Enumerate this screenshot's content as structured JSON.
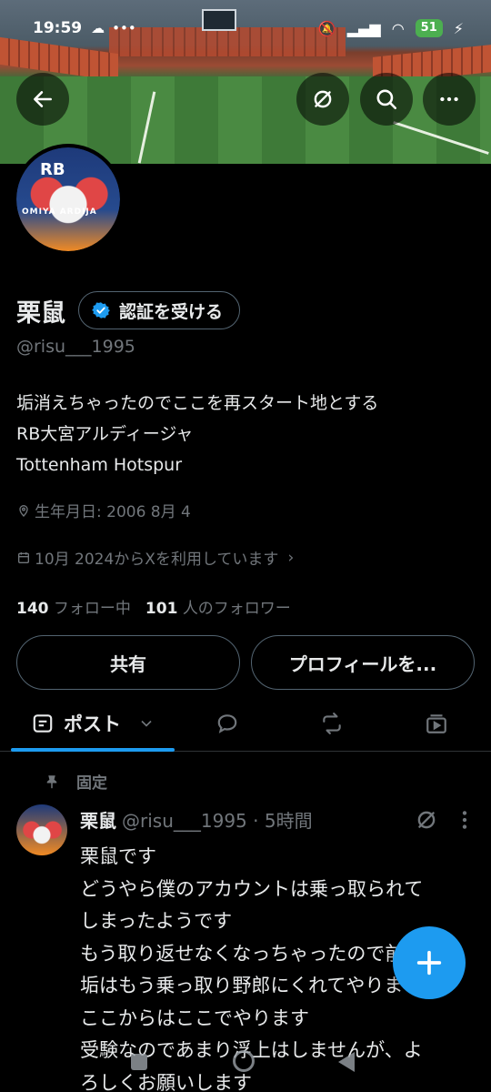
{
  "status_bar": {
    "time": "19:59",
    "battery": "51",
    "icons": [
      "moment-icon",
      "cloud-icon",
      "more-dots",
      "mute-icon",
      "signal-icon",
      "wifi-icon",
      "battery-icon",
      "charging-icon"
    ]
  },
  "top_bar": {
    "back_icon": "arrow-left-icon",
    "grok_icon": "grok-icon",
    "search_icon": "search-icon",
    "more_icon": "more-horizontal-icon"
  },
  "profile": {
    "display_name": "栗鼠",
    "verify_label": "認証を受ける",
    "handle": "@risu___1995",
    "bio_lines": [
      "垢消えちゃったのでここを再スタート地とする",
      "RB大宮アルディージャ",
      "Tottenham Hotspur"
    ],
    "birthday": "生年月日: 2006 8月 4",
    "joined": "10月 2024からXを利用しています",
    "following_count": "140",
    "following_label": "フォロー中",
    "followers_count": "101",
    "followers_label": "人のフォロワー",
    "avatar_text": "RB",
    "avatar_ring_text": "OMIYA ARDIJA"
  },
  "actions": {
    "share_label": "共有",
    "edit_label": "プロフィールを..."
  },
  "tabs": {
    "active_label": "ポスト",
    "items": [
      "posts-tab",
      "replies-tab",
      "reposts-tab",
      "media-tab"
    ]
  },
  "pinned_post": {
    "pinned_label": "固定",
    "author_name": "栗鼠",
    "meta": "@risu___1995 · 5時間",
    "body": "栗鼠です\nどうやら僕のアカウントは乗っ取られて\nしまったようです\nもう取り返せなくなっちゃったので前の\n垢はもう乗っ取り野郎にくれてやります\nここからはここでやります\n受験なのであまり浮上はしませんが、よ\nろしくお願いします"
  },
  "colors": {
    "accent": "#1d9bf0",
    "background": "#000000",
    "text_primary": "#e7e9ea",
    "text_secondary": "#71767b",
    "border": "#536471"
  }
}
